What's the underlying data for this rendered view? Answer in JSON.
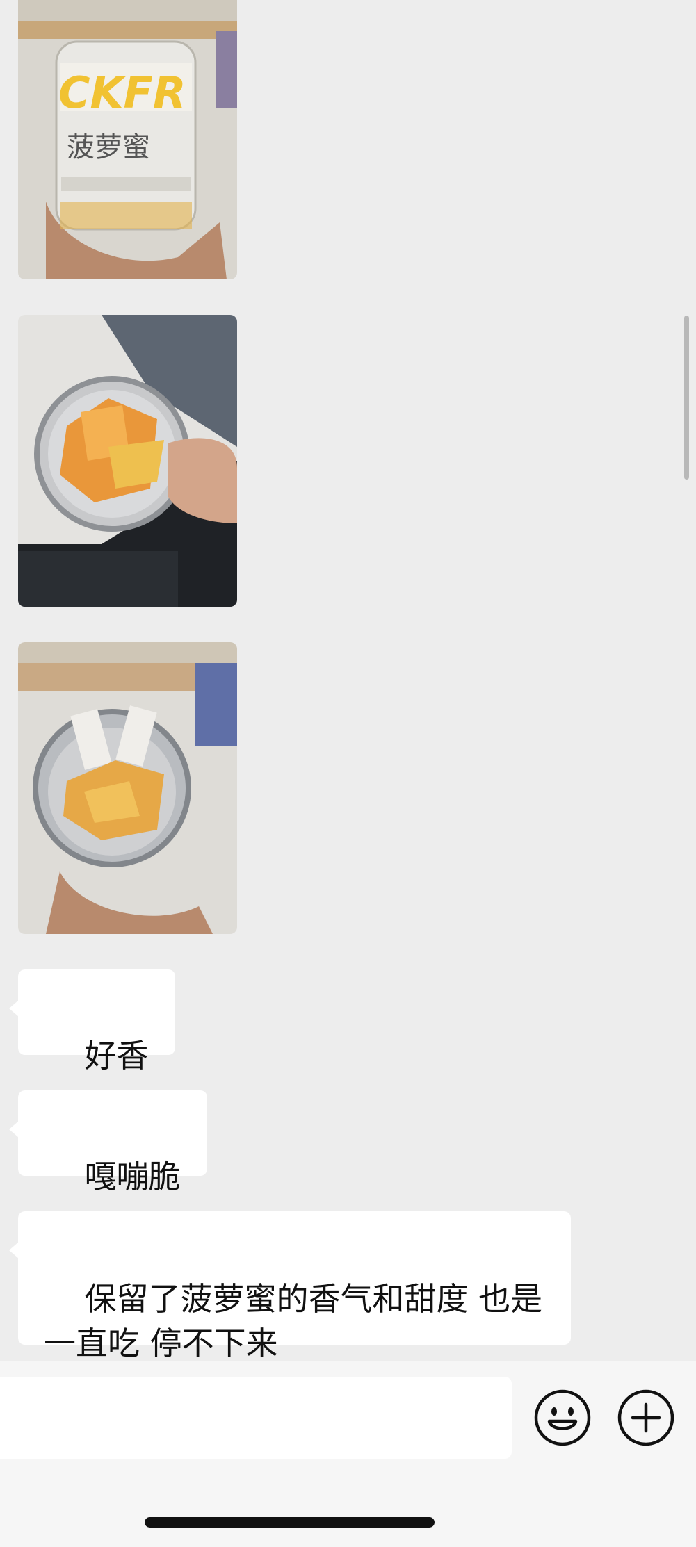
{
  "chat": {
    "images": [
      {
        "name": "photo-jar-front",
        "label_cn": "菠萝蜜",
        "label_brand": "CKFR"
      },
      {
        "name": "photo-jar-open-hand"
      },
      {
        "name": "photo-jar-open-topview"
      }
    ],
    "messages": [
      {
        "text": "好香"
      },
      {
        "text": "嘎嘣脆"
      },
      {
        "text": "保留了菠萝蜜的香气和甜度 也是\n一直吃 停不下来"
      }
    ]
  },
  "input_bar": {
    "message_value": "",
    "icons": [
      "emoji-icon",
      "plus-icon"
    ]
  },
  "colors": {
    "background": "#ededed",
    "bubble": "#ffffff",
    "input_bar": "#f6f6f6"
  }
}
